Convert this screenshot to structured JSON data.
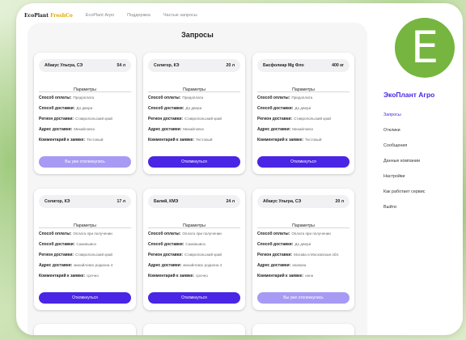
{
  "topnav": {
    "brand_main": "EcoPlant",
    "brand_accent": "FreshCo",
    "links": [
      "EcoPlant Агро",
      "Поддержка",
      "Частые запросы"
    ]
  },
  "page": {
    "title": "Запросы"
  },
  "labels": {
    "params": "Параметры",
    "payment": "Способ оплаты:",
    "delivery": "Способ доставки:",
    "region": "Регион доставки:",
    "address": "Адрес доставки:",
    "comment": "Комментарий к заявке:"
  },
  "cards": [
    {
      "product": "Абакус Ультра, СЭ",
      "qty": "54 л",
      "payment": "Предоплата",
      "delivery": "До двери",
      "region": "Ставропольский край",
      "address": "Михайловск",
      "comment": "Тестовый",
      "button": "Вы уже откликнулись",
      "disabled": true
    },
    {
      "product": "Солигор, КЭ",
      "qty": "20 л",
      "payment": "Предоплата",
      "delivery": "До двери",
      "region": "Ставропольский край",
      "address": "Михайловск",
      "comment": "Тестовый",
      "button": "Откликнуться",
      "disabled": false
    },
    {
      "product": "Басфолиар Mg Фло",
      "qty": "400 кг",
      "payment": "Предоплата",
      "delivery": "До двери",
      "region": "Ставропольский край",
      "address": "Михайловск",
      "comment": "Тестовый",
      "button": "Откликнуться",
      "disabled": false
    },
    {
      "product": "Солигор, КЭ",
      "qty": "17 л",
      "payment": "Оплата при получении",
      "delivery": "Самовывоз",
      "region": "Ставропольский край",
      "address": "михайловск родиона 4",
      "comment": "срочно",
      "button": "Откликнуться",
      "disabled": false
    },
    {
      "product": "Балий, КМЭ",
      "qty": "24 л",
      "payment": "Оплата при получении",
      "delivery": "Самовывоз",
      "region": "Ставропольский край",
      "address": "михайловск родиона 4",
      "comment": "срочно",
      "button": "Откликнуться",
      "disabled": false
    },
    {
      "product": "Абакус Ультра, СЭ",
      "qty": "20 л",
      "payment": "Оплата при получении",
      "delivery": "До двери",
      "region": "Москва и Московская обл.",
      "address": "asasasa",
      "comment": "нннн",
      "button": "Вы уже откликнулись",
      "disabled": true
    }
  ],
  "sidebar": {
    "logo_letter": "E",
    "company": "ЭкоПлант Агро",
    "items": [
      "Запросы",
      "Отклики",
      "Сообщения",
      "Данные компании",
      "Настройки",
      "Как работает сервис",
      "Выйти"
    ]
  },
  "colors": {
    "accent": "#4a25e5",
    "accent_disabled": "#a79af5",
    "logo_green": "#76b53f",
    "brand_accent": "#e0a800"
  }
}
